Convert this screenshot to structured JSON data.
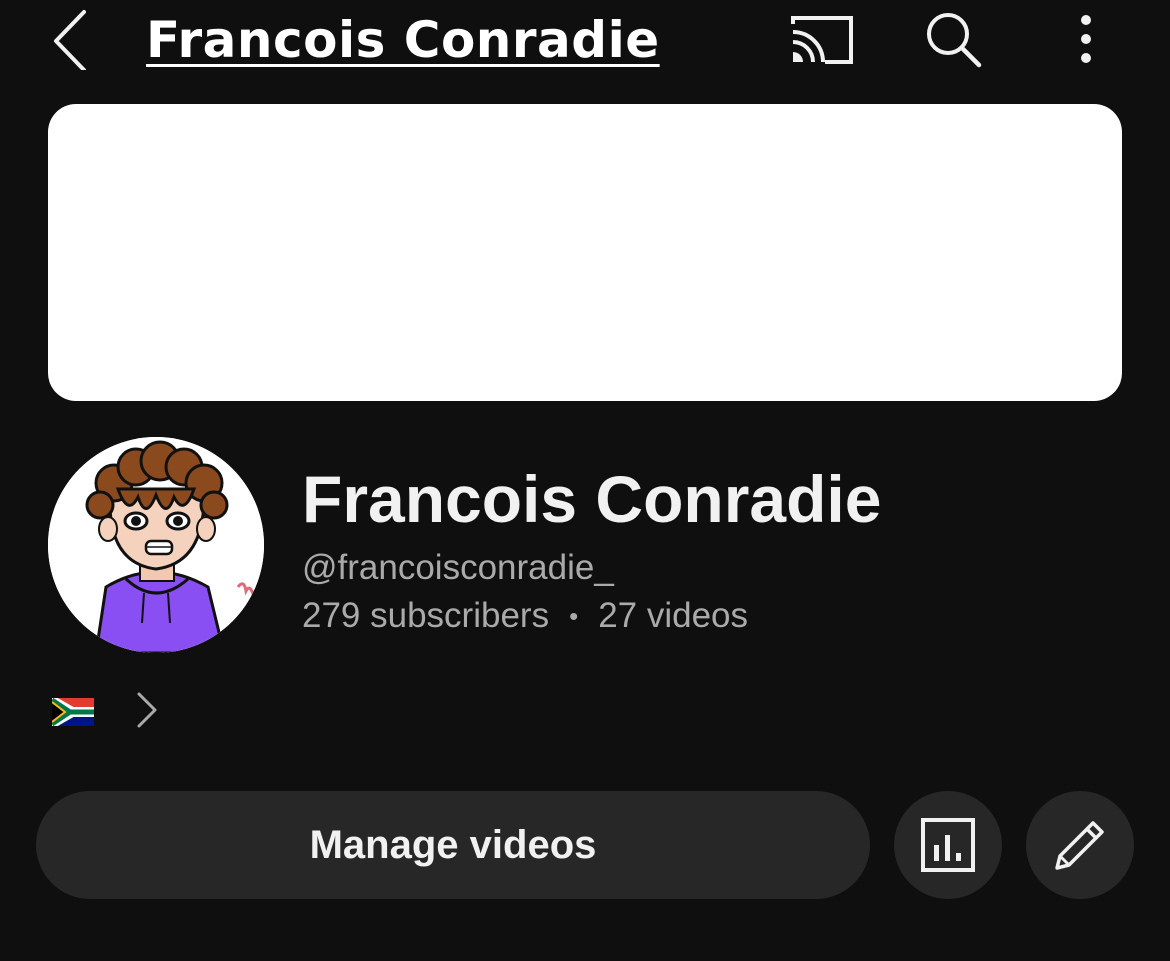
{
  "header": {
    "title": "Francois Conradie",
    "icons": [
      "back-icon",
      "cast-icon",
      "search-icon",
      "more-vert-icon"
    ]
  },
  "channel": {
    "name": "Francois Conradie",
    "handle": "@francoisconradie_",
    "subscribers": "279 subscribers",
    "separator": "•",
    "videos": "27 videos",
    "country_flag": "south-africa-flag-icon"
  },
  "actions": {
    "manage_videos_label": "Manage videos",
    "analytics_icon": "analytics-icon",
    "edit_icon": "pencil-icon"
  },
  "colors": {
    "background": "#0f0f0f",
    "banner": "#ffffff",
    "button_bg": "#272727",
    "primary_text": "#f1f1f1",
    "secondary_text": "#aaaaaa"
  }
}
